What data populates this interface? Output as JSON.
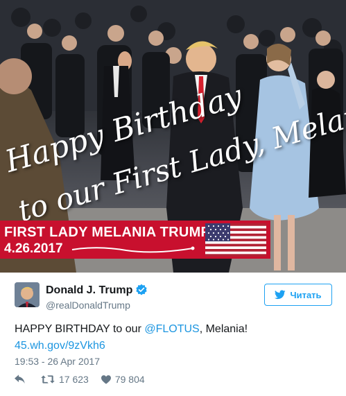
{
  "photo": {
    "overlay_line1": "Happy Birthday",
    "overlay_line2": "to our First Lady, Melania!",
    "banner_title": "FIRST LADY MELANIA TRUMP",
    "banner_date": "4.26.2017",
    "banner_color": "#c8102e"
  },
  "tweet": {
    "display_name": "Donald J. Trump",
    "handle": "@realDonaldTrump",
    "follow_label": "Читать",
    "text_before": "HAPPY BIRTHDAY to our ",
    "mention": "@FLOTUS",
    "text_after": ", Melania!",
    "link": "45.wh.gov/9zVkh6",
    "timestamp": "19:53 - 26 Apr 2017",
    "retweets": "17 623",
    "likes": "79 804",
    "accent_color": "#1da1f2"
  },
  "icons": {
    "verified": "verified-badge-icon",
    "twitter_bird": "twitter-bird-icon",
    "reply": "reply-icon",
    "retweet": "retweet-icon",
    "like": "heart-icon"
  }
}
